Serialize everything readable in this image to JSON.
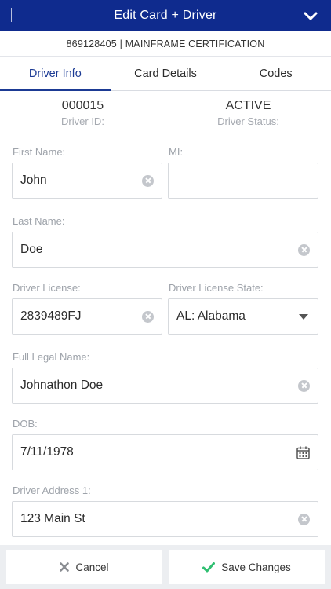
{
  "header": {
    "title": "Edit Card + Driver",
    "menu_icon": "menu-bars-icon",
    "collapse_icon": "chevron-down-icon",
    "bg_color": "#0f2b8e"
  },
  "subheader": {
    "text": "869128405 | MAINFRAME CERTIFICATION"
  },
  "tabs": [
    {
      "label": "Driver Info",
      "active": true
    },
    {
      "label": "Card Details",
      "active": false
    },
    {
      "label": "Codes",
      "active": false
    }
  ],
  "status": {
    "driver_id_value": "000015",
    "driver_id_label": "Driver ID:",
    "driver_status_value": "ACTIVE",
    "driver_status_label": "Driver Status:"
  },
  "form": {
    "first_name": {
      "label": "First Name:",
      "value": "John"
    },
    "mi": {
      "label": "MI:",
      "value": ""
    },
    "last_name": {
      "label": "Last Name:",
      "value": "Doe"
    },
    "driver_license": {
      "label": "Driver License:",
      "value": "2839489FJ"
    },
    "driver_license_state": {
      "label": "Driver License State:",
      "value": "AL: Alabama"
    },
    "full_legal_name": {
      "label": "Full Legal Name:",
      "value": "Johnathon Doe"
    },
    "dob": {
      "label": "DOB:",
      "value": "7/11/1978"
    },
    "driver_address_1": {
      "label": "Driver Address 1:",
      "value": "123 Main St"
    }
  },
  "footer": {
    "cancel_label": "Cancel",
    "save_label": "Save Changes",
    "save_icon_color": "#2fbf71",
    "cancel_icon_color": "#8a8d92"
  }
}
